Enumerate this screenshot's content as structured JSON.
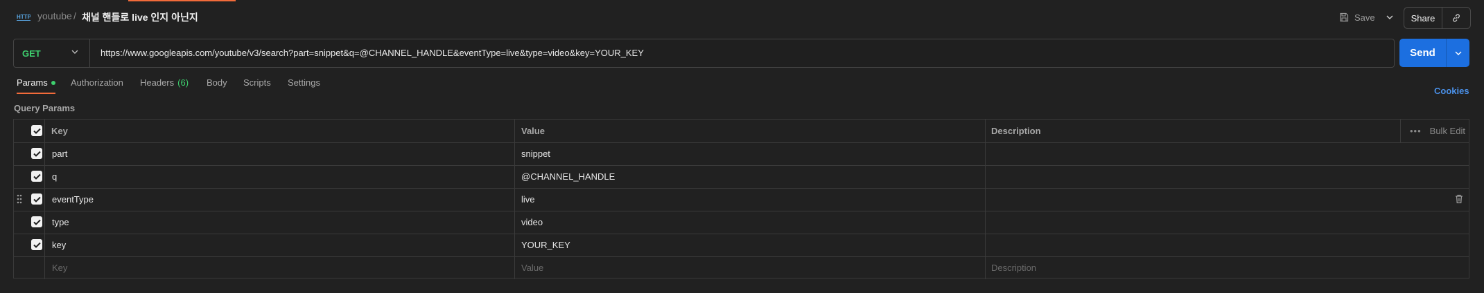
{
  "header": {
    "icon": "http-request-icon",
    "breadcrumb_parent": "youtube",
    "breadcrumb_sep": "/",
    "request_name": "채널 핸들로 live 인지 아닌지",
    "save_label": "Save",
    "share_label": "Share"
  },
  "request": {
    "method": "GET",
    "url": "https://www.googleapis.com/youtube/v3/search?part=snippet&q=@CHANNEL_HANDLE&eventType=live&type=video&key=YOUR_KEY",
    "send_label": "Send"
  },
  "tabs": [
    {
      "label": "Params",
      "active": true,
      "indicator": true
    },
    {
      "label": "Authorization"
    },
    {
      "label": "Headers",
      "count": "(6)"
    },
    {
      "label": "Body"
    },
    {
      "label": "Scripts"
    },
    {
      "label": "Settings"
    }
  ],
  "cookies_label": "Cookies",
  "section_label": "Query Params",
  "table": {
    "headers": {
      "key": "Key",
      "value": "Value",
      "description": "Description",
      "bulk_edit": "Bulk Edit"
    },
    "rows": [
      {
        "key": "part",
        "value": "snippet",
        "checked": true
      },
      {
        "key": "q",
        "value": "@CHANNEL_HANDLE",
        "checked": true
      },
      {
        "key": "eventType",
        "value": "live",
        "checked": true
      },
      {
        "key": "type",
        "value": "video",
        "checked": true
      },
      {
        "key": "key",
        "value": "YOUR_KEY",
        "checked": true
      }
    ],
    "placeholders": {
      "key": "Key",
      "value": "Value",
      "description": "Description"
    }
  },
  "colors": {
    "accent": "#f26b3a",
    "send": "#1c6fe0",
    "method": "#3ecf6e",
    "link": "#4a90e8"
  }
}
